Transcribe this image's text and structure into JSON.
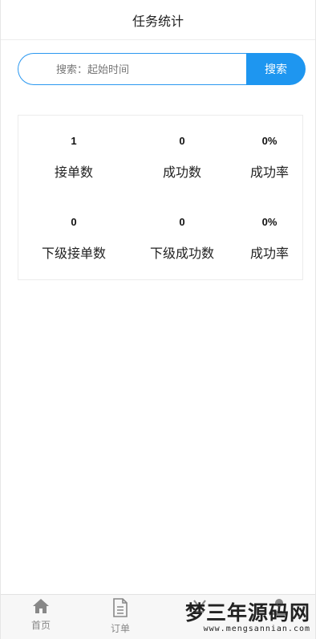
{
  "header": {
    "title": "任务统计"
  },
  "search": {
    "placeholder": "搜索：起始时间",
    "value": "",
    "button_label": "搜索"
  },
  "stats": {
    "rows": [
      [
        {
          "value": "1",
          "label": "接单数"
        },
        {
          "value": "0",
          "label": "成功数"
        },
        {
          "value": "0%",
          "label": "成功率"
        }
      ],
      [
        {
          "value": "0",
          "label": "下级接单数"
        },
        {
          "value": "0",
          "label": "下级成功数"
        },
        {
          "value": "0%",
          "label": "成功率"
        }
      ]
    ]
  },
  "tabbar": {
    "items": [
      {
        "label": "首页",
        "icon": "home-icon"
      },
      {
        "label": "订单",
        "icon": "document-icon"
      },
      {
        "label": "",
        "icon": "yen-icon"
      },
      {
        "label": "",
        "icon": "user-icon"
      }
    ]
  },
  "watermark": {
    "main": "梦三年源码网",
    "sub": "www.mengsannian.com"
  },
  "colors": {
    "accent": "#1e96f0",
    "border": "#ececec",
    "tab_icon": "#888888"
  }
}
